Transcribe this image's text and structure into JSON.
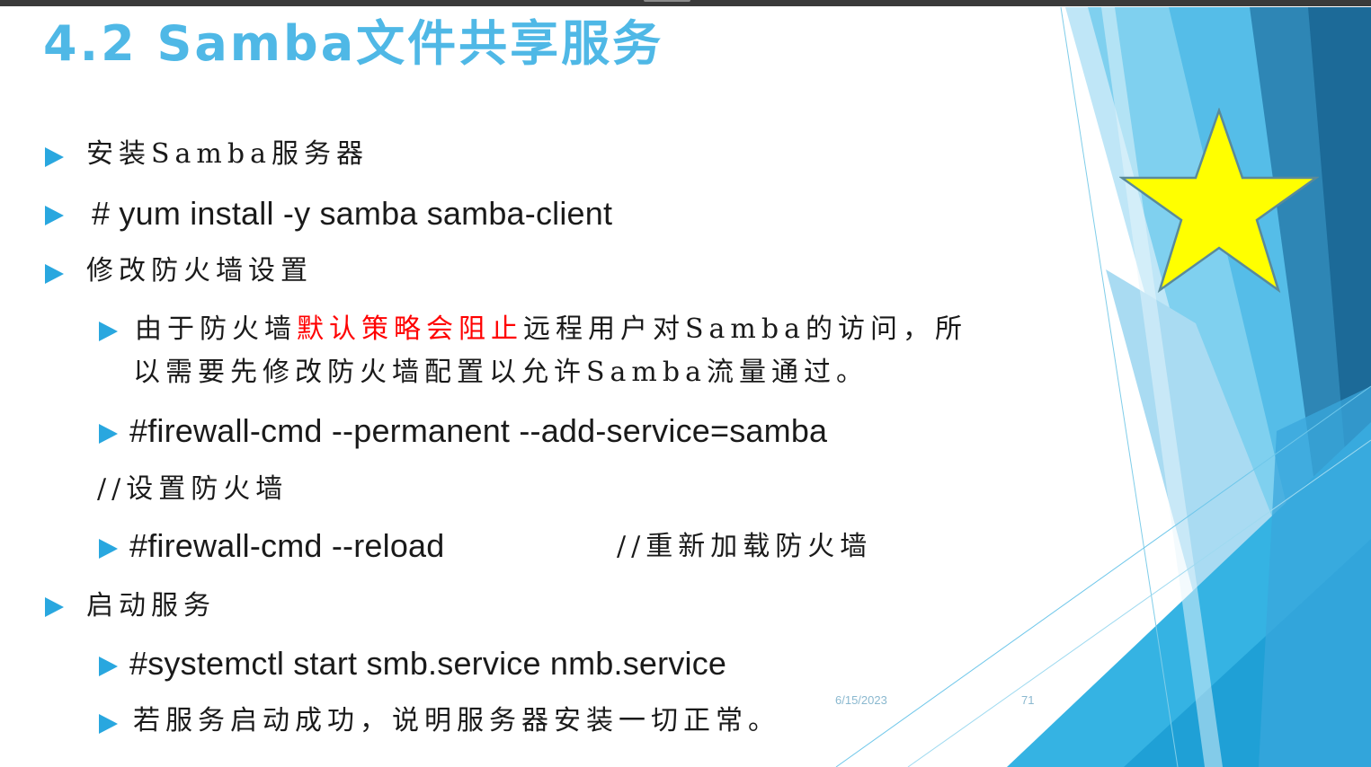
{
  "slide": {
    "title": "4.2 Samba文件共享服务",
    "items": [
      {
        "text": "安装Samba服务器"
      },
      {
        "text": "# yum  install  -y  samba  samba-client"
      },
      {
        "text": "修改防火墙设置"
      },
      {
        "text_before": "由于防火墙",
        "text_highlight": "默认策略会阻止",
        "text_after": "远程用户对Samba的访问，所",
        "text_line2": "以需要先修改防火墙配置以允许Samba流量通过。",
        "highlight_color": "#ff0000"
      },
      {
        "text": "#firewall-cmd  --permanent  --add-service=samba"
      },
      {
        "text": "//设置防火墙"
      },
      {
        "text": "#firewall-cmd  --reload",
        "comment": "//重新加载防火墙"
      },
      {
        "text": "启动服务"
      },
      {
        "text": "#systemctl  start  smb.service  nmb.service"
      },
      {
        "text": "若服务启动成功，说明服务器安装一切正常。"
      }
    ],
    "footer_date": "6/15/2023",
    "page_number": "71"
  },
  "colors": {
    "title": "#4fb8e6",
    "bullet": "#29a7df",
    "star_fill": "#ffff00",
    "star_stroke": "#5a8a9a"
  },
  "icons": [
    "bullet-triangle-icon",
    "star-icon"
  ]
}
